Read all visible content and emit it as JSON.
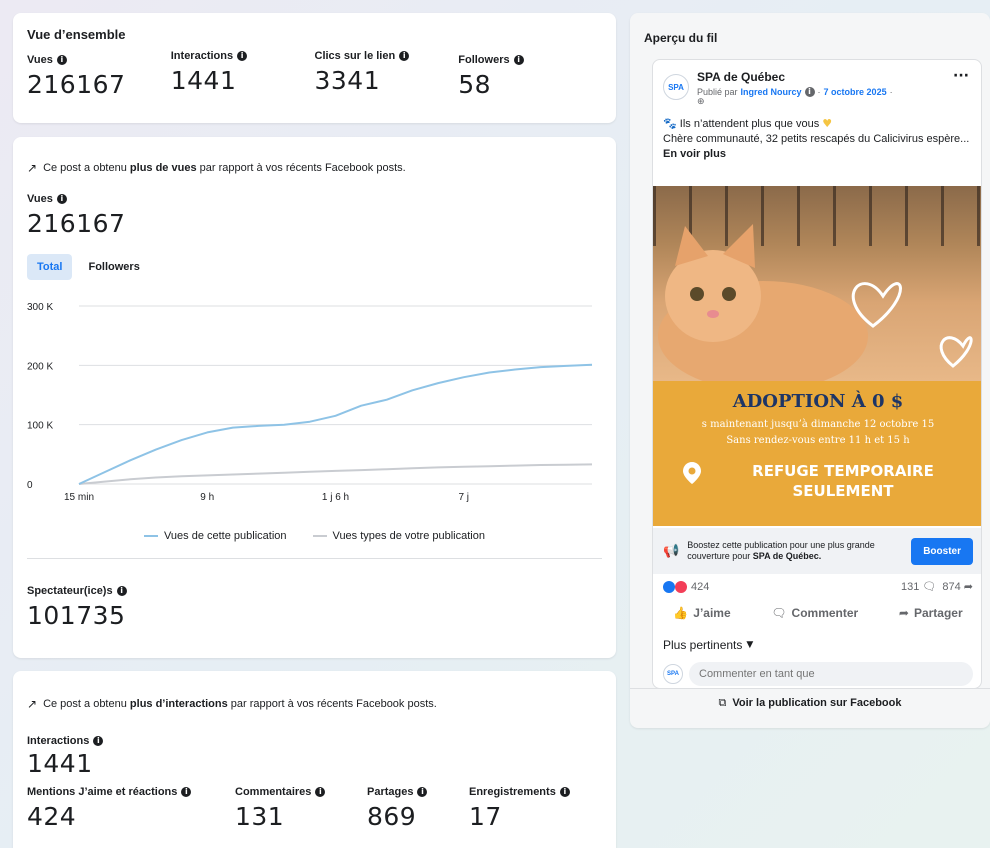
{
  "overview": {
    "title": "Vue d’ensemble",
    "metrics": [
      {
        "label": "Vues",
        "value": "216167"
      },
      {
        "label": "Interactions",
        "value": "1441"
      },
      {
        "label": "Clics sur le lien",
        "value": "3341"
      },
      {
        "label": "Followers",
        "value": "58"
      }
    ]
  },
  "views_section": {
    "trend_prefix": "Ce post a obtenu",
    "trend_bold": "plus de vues",
    "trend_suffix": "par rapport à vos récents Facebook posts.",
    "views_label": "Vues",
    "views_value": "216167",
    "toggle": {
      "total": "Total",
      "followers": "Followers"
    },
    "legend": {
      "series1": "Vues de cette publication",
      "series2": "Vues types de votre publication"
    },
    "viewers_label": "Spectateur(ice)s",
    "viewers_value": "101735"
  },
  "chart_data": {
    "type": "line",
    "x": [
      0,
      1,
      2,
      3,
      4,
      5,
      6,
      7,
      8,
      9,
      10,
      11,
      12,
      13,
      14,
      15,
      16,
      17,
      18,
      19,
      20
    ],
    "x_ticks": [
      {
        "pos": 0,
        "label": "15 min"
      },
      {
        "pos": 5,
        "label": "9 h"
      },
      {
        "pos": 10,
        "label": "1 j 6 h"
      },
      {
        "pos": 15,
        "label": "7 j"
      }
    ],
    "y_ticks": [
      {
        "value": 0,
        "label": "0"
      },
      {
        "value": 100000,
        "label": "100 K"
      },
      {
        "value": 200000,
        "label": "200 K"
      },
      {
        "value": 300000,
        "label": "300 K"
      }
    ],
    "ylim": [
      0,
      300000
    ],
    "series": [
      {
        "name": "Vues de cette publication",
        "color": "#8ec3e6",
        "values": [
          0,
          20000,
          40000,
          58000,
          74000,
          87000,
          95000,
          98000,
          100000,
          105000,
          115000,
          132000,
          142000,
          158000,
          170000,
          180000,
          188000,
          193000,
          197000,
          199000,
          201000
        ]
      },
      {
        "name": "Vues types de votre publication",
        "color": "#c9ccd1",
        "values": [
          0,
          4000,
          8000,
          11000,
          13000,
          14500,
          16000,
          17500,
          19000,
          20500,
          22000,
          23500,
          25000,
          26500,
          28000,
          29000,
          30000,
          31000,
          32000,
          32500,
          33000
        ]
      }
    ]
  },
  "interactions_section": {
    "trend_prefix": "Ce post a obtenu",
    "trend_bold": "plus d’interactions",
    "trend_suffix": "par rapport à vos récents Facebook posts.",
    "label": "Interactions",
    "value": "1441",
    "breakdown": [
      {
        "label": "Mentions J’aime et réactions",
        "value": "424"
      },
      {
        "label": "Commentaires",
        "value": "131"
      },
      {
        "label": "Partages",
        "value": "869"
      },
      {
        "label": "Enregistrements",
        "value": "17"
      }
    ]
  },
  "preview": {
    "title": "Aperçu du fil",
    "page_name": "SPA de Québec",
    "avatar_text": "SPA",
    "published_by": "Publié par",
    "author": "Ingred Nourcy",
    "date": "7 octobre 2025",
    "text_line1": "Ils n’attendent plus que vous",
    "text_line2": "Chère communauté, 32 petits rescapés du Calicivirus espère...",
    "see_more": "En voir plus",
    "image_title": "ADOPTION À 0 $",
    "image_line1": "s maintenant jusqu’à dimanche 12 octobre 15",
    "image_line2": "Sans rendez-vous entre 11 h et 15 h",
    "image_refuge_1": "REFUGE TEMPORAIRE",
    "image_refuge_2": "SEULEMENT",
    "boost_text_1": "Boostez cette publication pour une plus grande couverture pour",
    "boost_text_bold": "SPA de Québec.",
    "boost_button": "Booster",
    "reaction_count": "424",
    "comment_count": "131",
    "share_count": "874",
    "actions": {
      "like": "J’aime",
      "comment": "Commenter",
      "share": "Partager"
    },
    "sort_label": "Plus pertinents",
    "comment_placeholder": "Commenter en tant que",
    "fb_link": "Voir la publication sur Facebook"
  }
}
